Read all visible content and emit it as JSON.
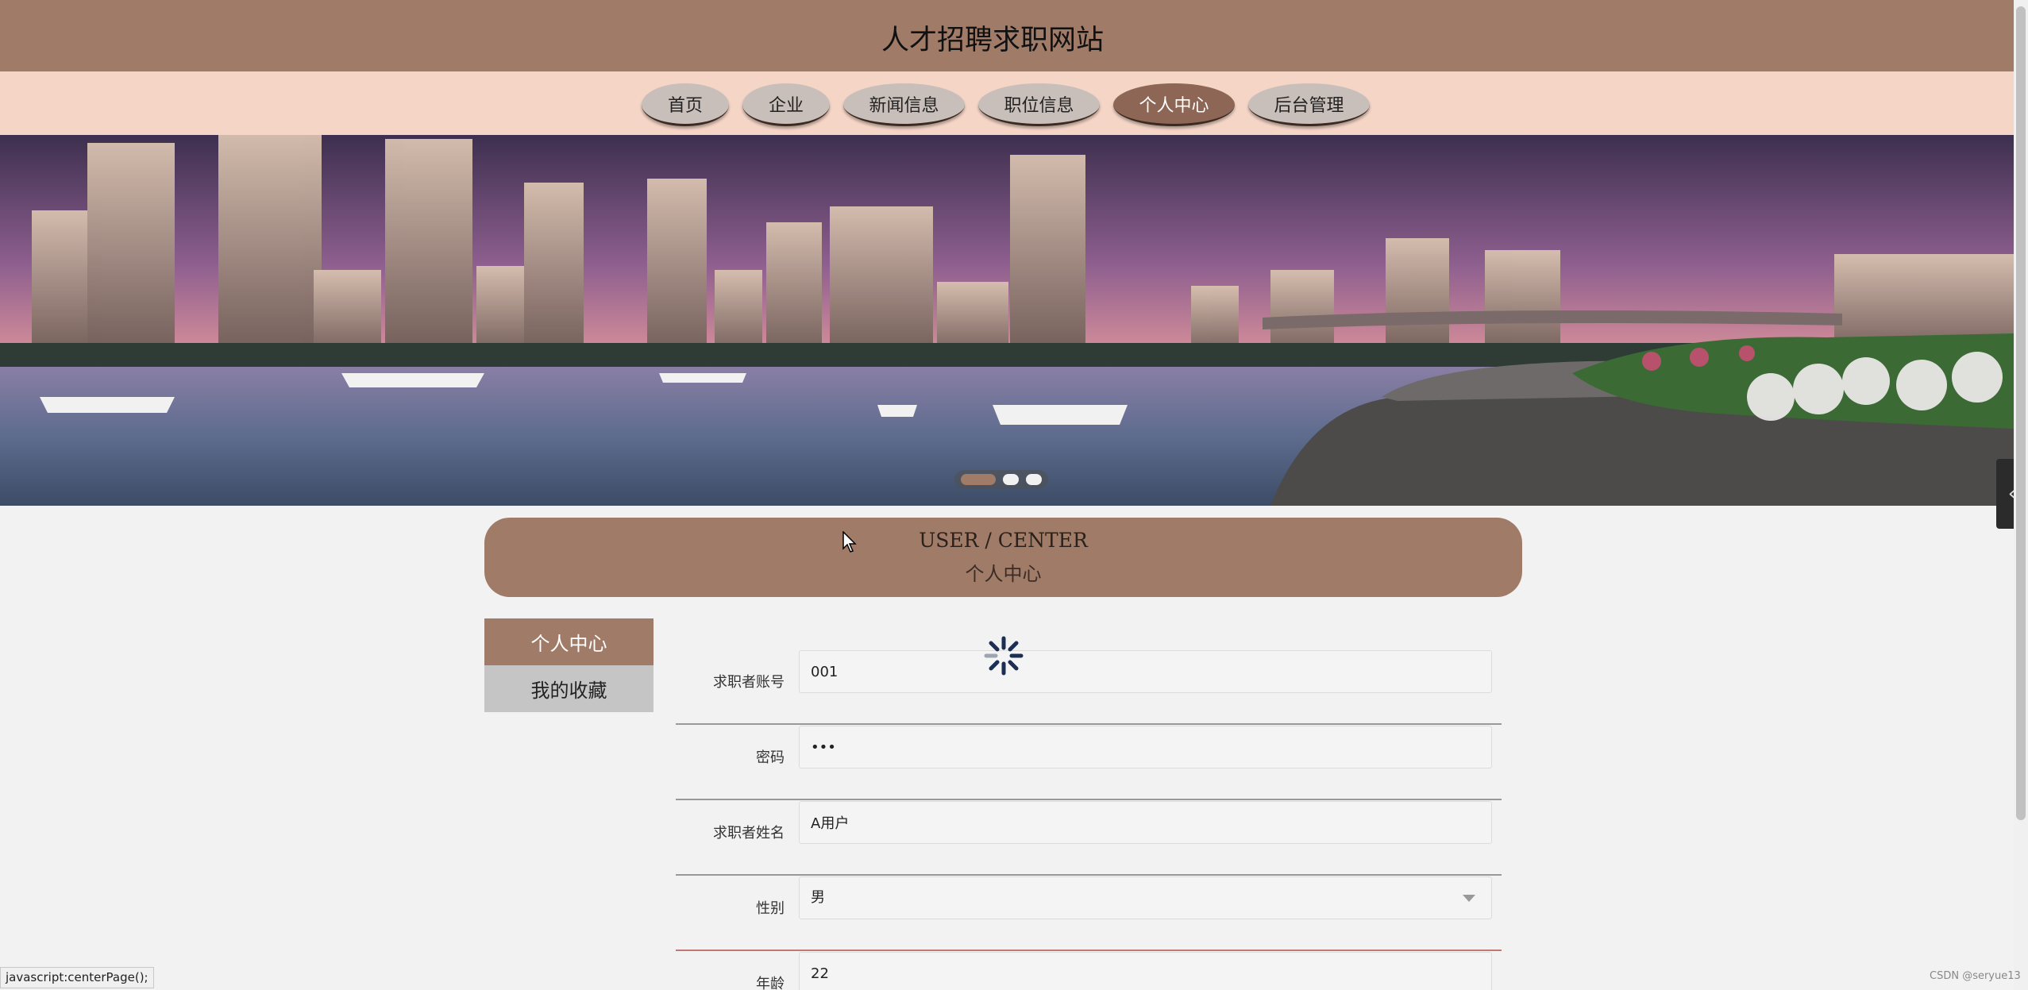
{
  "header": {
    "title": "人才招聘求职网站"
  },
  "nav": {
    "items": [
      {
        "label": "首页",
        "active": false
      },
      {
        "label": "企业",
        "active": false
      },
      {
        "label": "新闻信息",
        "active": false
      },
      {
        "label": "职位信息",
        "active": false
      },
      {
        "label": "个人中心",
        "active": true
      },
      {
        "label": "后台管理",
        "active": false
      }
    ]
  },
  "banner": {
    "slides": 3,
    "current_slide": 1
  },
  "section": {
    "title_en": "USER / CENTER",
    "title_cn": "个人中心"
  },
  "side_menu": {
    "items": [
      {
        "label": "个人中心",
        "active": true
      },
      {
        "label": "我的收藏",
        "active": false
      }
    ]
  },
  "form": {
    "fields": [
      {
        "label": "求职者账号",
        "value": "001",
        "type": "text"
      },
      {
        "label": "密码",
        "value": "•••",
        "type": "password"
      },
      {
        "label": "求职者姓名",
        "value": "A用户",
        "type": "text"
      },
      {
        "label": "性别",
        "value": "男",
        "type": "select"
      },
      {
        "label": "年龄",
        "value": "22",
        "type": "text"
      }
    ]
  },
  "status_bar": {
    "link": "javascript:centerPage();"
  },
  "watermark": "CSDN @seryue13",
  "colors": {
    "primary": "#a07b68",
    "nav_bg": "#f5d5c6",
    "page_bg": "#f2f2f2"
  }
}
